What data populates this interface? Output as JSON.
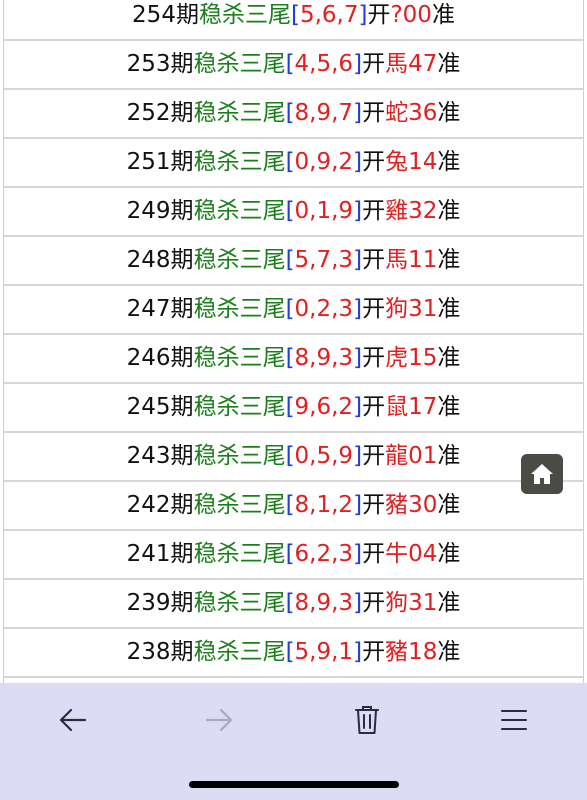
{
  "rows": [
    {
      "issue": "254期",
      "label": "稳杀三尾",
      "open": "[",
      "nums": "5,6,7",
      "close": "]",
      "kai": "开",
      "result": "?00",
      "zhun": "准"
    },
    {
      "issue": "253期",
      "label": "稳杀三尾",
      "open": "[",
      "nums": "4,5,6",
      "close": "]",
      "kai": "开",
      "result": "馬47",
      "zhun": "准"
    },
    {
      "issue": "252期",
      "label": "稳杀三尾",
      "open": "[",
      "nums": "8,9,7",
      "close": "]",
      "kai": "开",
      "result": "蛇36",
      "zhun": "准"
    },
    {
      "issue": "251期",
      "label": "稳杀三尾",
      "open": "[",
      "nums": "0,9,2",
      "close": "]",
      "kai": "开",
      "result": "兔14",
      "zhun": "准"
    },
    {
      "issue": "249期",
      "label": "稳杀三尾",
      "open": "[",
      "nums": "0,1,9",
      "close": "]",
      "kai": "开",
      "result": "雞32",
      "zhun": "准"
    },
    {
      "issue": "248期",
      "label": "稳杀三尾",
      "open": "[",
      "nums": "5,7,3",
      "close": "]",
      "kai": "开",
      "result": "馬11",
      "zhun": "准"
    },
    {
      "issue": "247期",
      "label": "稳杀三尾",
      "open": "[",
      "nums": "0,2,3",
      "close": "]",
      "kai": "开",
      "result": "狗31",
      "zhun": "准"
    },
    {
      "issue": "246期",
      "label": "稳杀三尾",
      "open": "[",
      "nums": "8,9,3",
      "close": "]",
      "kai": "开",
      "result": "虎15",
      "zhun": "准"
    },
    {
      "issue": "245期",
      "label": "稳杀三尾",
      "open": "[",
      "nums": "9,6,2",
      "close": "]",
      "kai": "开",
      "result": "鼠17",
      "zhun": "准"
    },
    {
      "issue": "243期",
      "label": "稳杀三尾",
      "open": "[",
      "nums": "0,5,9",
      "close": "]",
      "kai": "开",
      "result": "龍01",
      "zhun": "准"
    },
    {
      "issue": "242期",
      "label": "稳杀三尾",
      "open": "[",
      "nums": "8,1,2",
      "close": "]",
      "kai": "开",
      "result": "豬30",
      "zhun": "准"
    },
    {
      "issue": "241期",
      "label": "稳杀三尾",
      "open": "[",
      "nums": "6,2,3",
      "close": "]",
      "kai": "开",
      "result": "牛04",
      "zhun": "准"
    },
    {
      "issue": "239期",
      "label": "稳杀三尾",
      "open": "[",
      "nums": "8,9,3",
      "close": "]",
      "kai": "开",
      "result": "狗31",
      "zhun": "准"
    },
    {
      "issue": "238期",
      "label": "稳杀三尾",
      "open": "[",
      "nums": "5,9,1",
      "close": "]",
      "kai": "开",
      "result": "豬18",
      "zhun": "准"
    }
  ],
  "colors": {
    "label": "#1a7f1a",
    "bracket": "#1f3fd6",
    "highlight": "#e02020",
    "toolbar": "#dcdcf5",
    "home_button": "#4b4b46"
  },
  "icons": {
    "home": "home-icon",
    "back": "back-arrow-icon",
    "forward": "forward-arrow-icon",
    "trash": "trash-icon",
    "menu": "menu-icon"
  }
}
